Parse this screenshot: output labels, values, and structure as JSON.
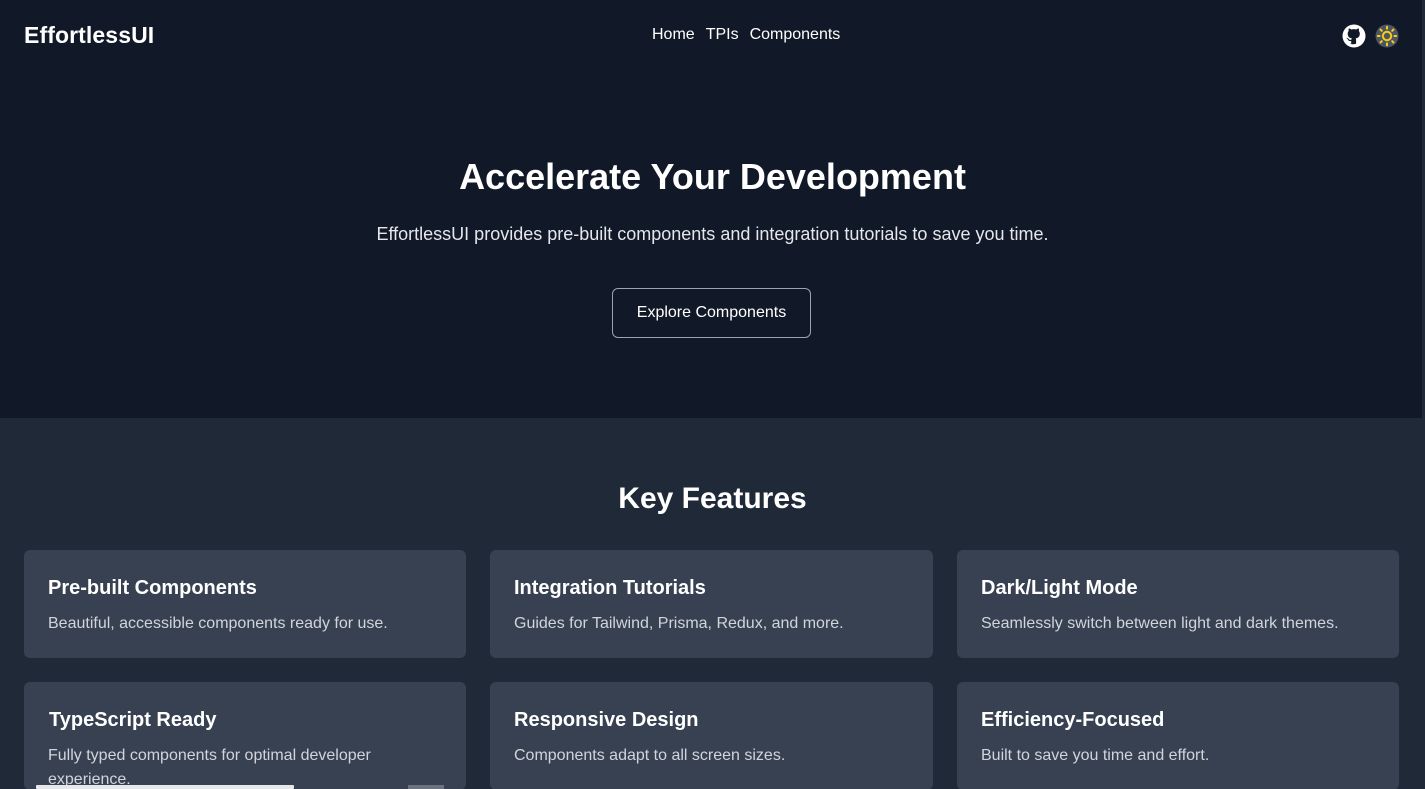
{
  "header": {
    "logo": "EffortlessUI",
    "nav": [
      {
        "label": "Home"
      },
      {
        "label": "TPIs"
      },
      {
        "label": "Components"
      }
    ],
    "icons": [
      "github-icon",
      "sun-icon"
    ]
  },
  "hero": {
    "title": "Accelerate Your Development",
    "subtitle": "EffortlessUI provides pre-built components and integration tutorials to save you time.",
    "cta_label": "Explore Components"
  },
  "features": {
    "title": "Key Features",
    "cards": [
      {
        "title": "Pre-built Components",
        "description": "Beautiful, accessible components ready for use."
      },
      {
        "title": "Integration Tutorials",
        "description": "Guides for Tailwind, Prisma, Redux, and more."
      },
      {
        "title": "Dark/Light Mode",
        "description": "Seamlessly switch between light and dark themes."
      },
      {
        "title": "TypeScript Ready",
        "description": "Fully typed components for optimal developer experience."
      },
      {
        "title": "Responsive Design",
        "description": "Components adapt to all screen sizes."
      },
      {
        "title": "Efficiency-Focused",
        "description": "Built to save you time and effort."
      }
    ]
  },
  "colors": {
    "background": "#111827",
    "section": "#1f2937",
    "card": "#374151",
    "sun_accent": "#facc15"
  }
}
